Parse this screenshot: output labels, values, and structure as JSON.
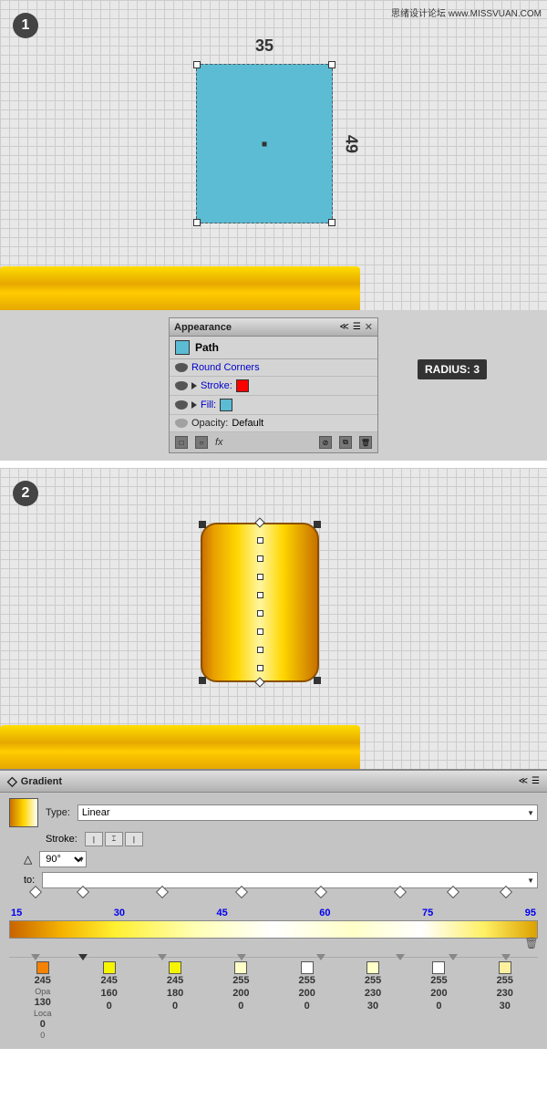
{
  "watermark": {
    "text": "思绪设计论坛 www.MISSVUAN.COM"
  },
  "section1": {
    "step": "1",
    "dimension_top": "35",
    "dimension_right": "49"
  },
  "appearance_panel": {
    "title": "Appearance",
    "path_label": "Path",
    "rows": [
      {
        "label": "Round Corners",
        "type": "effect",
        "tooltip": "RADIUS: 3"
      },
      {
        "label": "Stroke:",
        "type": "stroke"
      },
      {
        "label": "Fill:",
        "type": "fill"
      },
      {
        "label": "Opacity:",
        "type": "opacity",
        "value": "Default"
      }
    ]
  },
  "section2": {
    "step": "2"
  },
  "gradient_panel": {
    "title": "Gradient",
    "type_label": "Type:",
    "type_value": "Linear",
    "stroke_label": "Stroke:",
    "angle_label": "90°",
    "to_label": "to:",
    "stop_numbers": [
      "15",
      "30",
      "45",
      "60",
      "75",
      "95"
    ],
    "color_stops": [
      {
        "r": "245",
        "g": "130",
        "b": "0"
      },
      {
        "r": "245",
        "g": "245",
        "b": "0"
      },
      {
        "r": "245",
        "g": "245",
        "b": "0"
      },
      {
        "r": "255",
        "g": "255",
        "b": "245"
      },
      {
        "r": "255",
        "g": "255",
        "b": "255"
      },
      {
        "r": "255",
        "g": "255",
        "b": "230"
      },
      {
        "r": "255",
        "g": "255",
        "b": "255"
      },
      {
        "r": "255",
        "g": "255",
        "b": "230"
      }
    ],
    "value_rows": [
      {
        "top": "245",
        "mid": "130",
        "bot": "0"
      },
      {
        "top": "245",
        "mid": "160",
        "bot": "0"
      },
      {
        "top": "245",
        "mid": "180",
        "bot": "0"
      },
      {
        "top": "255",
        "mid": "200",
        "bot": "0"
      },
      {
        "top": "255",
        "mid": "200",
        "bot": "0"
      },
      {
        "top": "255",
        "mid": "230",
        "bot": "30"
      },
      {
        "top": "255",
        "mid": "200",
        "bot": "0"
      },
      {
        "top": "255",
        "mid": "230",
        "bot": "30"
      }
    ],
    "opacity_label": "Opa",
    "loc_label": "Loca"
  }
}
